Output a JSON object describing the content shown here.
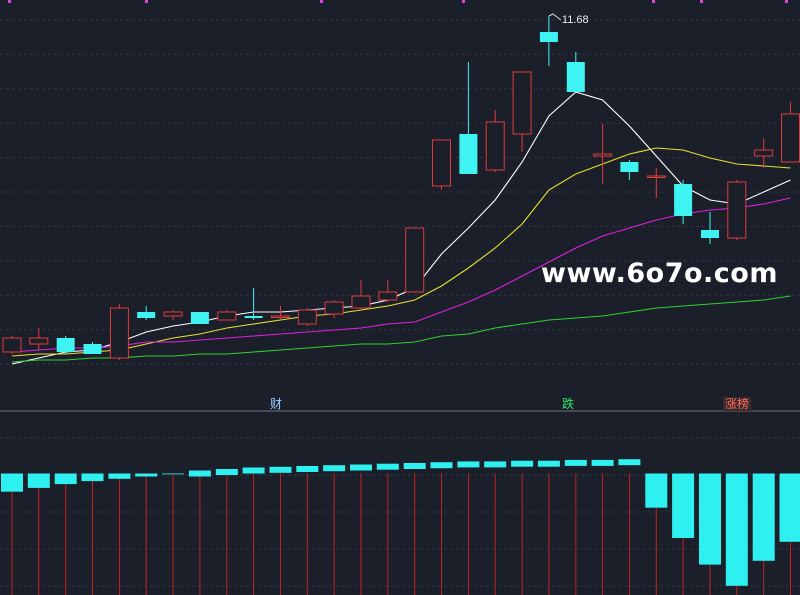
{
  "chart_data": {
    "type": "candlestick",
    "price_axis": {
      "min": 9.9,
      "max": 11.72
    },
    "high_label": "11.68",
    "candles": [
      {
        "o": 10.0,
        "c": 10.07,
        "h": 10.08,
        "l": 9.99
      },
      {
        "o": 10.04,
        "c": 10.07,
        "h": 10.12,
        "l": 10.01
      },
      {
        "o": 10.07,
        "c": 10.0,
        "h": 10.08,
        "l": 9.99
      },
      {
        "o": 10.04,
        "c": 9.99,
        "h": 10.05,
        "l": 9.99
      },
      {
        "o": 9.97,
        "c": 10.22,
        "h": 10.24,
        "l": 9.96
      },
      {
        "o": 10.2,
        "c": 10.17,
        "h": 10.23,
        "l": 10.16
      },
      {
        "o": 10.18,
        "c": 10.2,
        "h": 10.21,
        "l": 10.16
      },
      {
        "o": 10.2,
        "c": 10.14,
        "h": 10.2,
        "l": 10.14
      },
      {
        "o": 10.16,
        "c": 10.2,
        "h": 10.21,
        "l": 10.16
      },
      {
        "o": 10.18,
        "c": 10.17,
        "h": 10.32,
        "l": 10.16
      },
      {
        "o": 10.18,
        "c": 10.18,
        "h": 10.23,
        "l": 10.16
      },
      {
        "o": 10.14,
        "c": 10.21,
        "h": 10.22,
        "l": 10.13
      },
      {
        "o": 10.19,
        "c": 10.25,
        "h": 10.26,
        "l": 10.17
      },
      {
        "o": 10.22,
        "c": 10.28,
        "h": 10.36,
        "l": 10.21
      },
      {
        "o": 10.26,
        "c": 10.3,
        "h": 10.36,
        "l": 10.25
      },
      {
        "o": 10.3,
        "c": 10.62,
        "h": 10.62,
        "l": 10.3
      },
      {
        "o": 10.83,
        "c": 11.06,
        "h": 11.06,
        "l": 10.81
      },
      {
        "o": 11.09,
        "c": 10.89,
        "h": 11.45,
        "l": 10.89
      },
      {
        "o": 10.91,
        "c": 11.15,
        "h": 11.21,
        "l": 10.9
      },
      {
        "o": 11.09,
        "c": 11.4,
        "h": 11.4,
        "l": 11.0
      },
      {
        "o": 11.6,
        "c": 11.55,
        "h": 11.68,
        "l": 11.43
      },
      {
        "o": 11.45,
        "c": 11.3,
        "h": 11.5,
        "l": 11.3
      },
      {
        "o": 10.98,
        "c": 10.99,
        "h": 11.14,
        "l": 10.84
      },
      {
        "o": 10.95,
        "c": 10.9,
        "h": 10.96,
        "l": 10.86
      },
      {
        "o": 10.88,
        "c": 10.88,
        "h": 10.92,
        "l": 10.77
      },
      {
        "o": 10.84,
        "c": 10.68,
        "h": 10.86,
        "l": 10.64
      },
      {
        "o": 10.61,
        "c": 10.57,
        "h": 10.7,
        "l": 10.54
      },
      {
        "o": 10.57,
        "c": 10.85,
        "h": 10.86,
        "l": 10.56
      },
      {
        "o": 10.98,
        "c": 11.01,
        "h": 11.07,
        "l": 10.92
      },
      {
        "o": 10.95,
        "c": 11.19,
        "h": 11.25,
        "l": 10.95
      }
    ],
    "ma_lines": [
      {
        "color": "#ffffff",
        "values": [
          9.94,
          9.97,
          10.0,
          10.01,
          10.05,
          10.1,
          10.13,
          10.15,
          10.18,
          10.2,
          10.2,
          10.21,
          10.22,
          10.23,
          10.26,
          10.32,
          10.49,
          10.62,
          10.76,
          10.95,
          11.18,
          11.3,
          11.26,
          11.13,
          10.98,
          10.83,
          10.76,
          10.74,
          10.8,
          10.86
        ]
      },
      {
        "color": "#e6e030",
        "values": [
          9.98,
          9.99,
          9.99,
          10.0,
          10.01,
          10.04,
          10.07,
          10.09,
          10.12,
          10.14,
          10.16,
          10.18,
          10.19,
          10.21,
          10.23,
          10.26,
          10.33,
          10.42,
          10.52,
          10.64,
          10.81,
          10.89,
          10.94,
          10.99,
          11.02,
          11.01,
          10.97,
          10.94,
          10.93,
          10.92
        ]
      },
      {
        "color": "#e020e0",
        "values": [
          10.0,
          10.01,
          10.02,
          10.02,
          10.03,
          10.05,
          10.05,
          10.06,
          10.07,
          10.08,
          10.09,
          10.1,
          10.11,
          10.12,
          10.14,
          10.15,
          10.2,
          10.25,
          10.31,
          10.38,
          10.45,
          10.52,
          10.58,
          10.62,
          10.66,
          10.69,
          10.71,
          10.72,
          10.74,
          10.77
        ]
      },
      {
        "color": "#30d030",
        "values": [
          9.95,
          9.96,
          9.96,
          9.97,
          9.97,
          9.98,
          9.98,
          9.99,
          9.99,
          10.0,
          10.01,
          10.02,
          10.03,
          10.04,
          10.04,
          10.05,
          10.08,
          10.09,
          10.12,
          10.14,
          10.16,
          10.17,
          10.18,
          10.2,
          10.22,
          10.23,
          10.24,
          10.25,
          10.26,
          10.28
        ]
      }
    ],
    "histogram": {
      "axis": {
        "min": -160,
        "max": 60
      },
      "values": [
        -24,
        -19,
        -14,
        -10,
        -7,
        -4,
        -1,
        0,
        2,
        4,
        5,
        6,
        7,
        8,
        9,
        10,
        11,
        12,
        12,
        13,
        13,
        14,
        14,
        15,
        -45,
        -85,
        -120,
        -148,
        -115,
        -90
      ]
    }
  },
  "watermark": "www.6o7o.com",
  "flags": {
    "cai": "财",
    "die": "跌",
    "zhang": "涨榜"
  }
}
